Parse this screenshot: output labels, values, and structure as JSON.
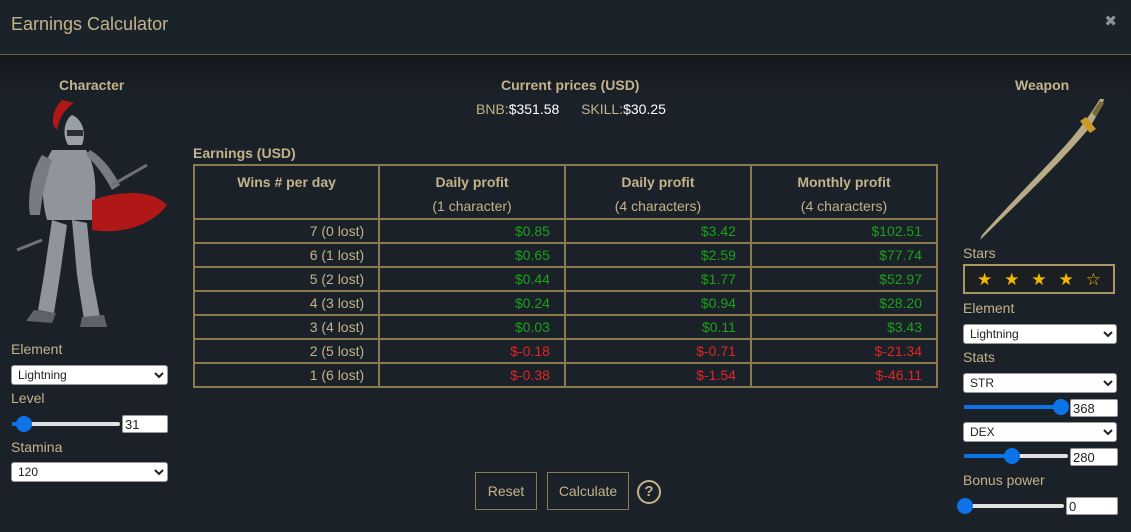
{
  "window": {
    "title": "Earnings Calculator",
    "close_icon": "close-icon"
  },
  "character": {
    "heading": "Character",
    "image": "armored-knight-figure",
    "element_label": "Element",
    "element_value": "Lightning",
    "level_label": "Level",
    "level_value": "31",
    "level_slider_fraction": 0.1,
    "stamina_label": "Stamina",
    "stamina_value": "120"
  },
  "prices": {
    "heading": "Current prices (USD)",
    "bnb_label": "BNB:",
    "bnb_value": "$351.58",
    "skill_label": "SKILL:",
    "skill_value": "$30.25"
  },
  "earnings": {
    "heading": "Earnings (USD)",
    "columns": [
      {
        "title": "Wins # per day",
        "sub": ""
      },
      {
        "title": "Daily profit",
        "sub": "(1 character)"
      },
      {
        "title": "Daily profit",
        "sub": "(4 characters)"
      },
      {
        "title": "Monthly profit",
        "sub": "(4 characters)"
      }
    ],
    "rows": [
      {
        "wins": "7 (0 lost)",
        "d1": "$0.85",
        "d4": "$3.42",
        "m4": "$102.51",
        "sign": "pos"
      },
      {
        "wins": "6 (1 lost)",
        "d1": "$0.65",
        "d4": "$2.59",
        "m4": "$77.74",
        "sign": "pos"
      },
      {
        "wins": "5 (2 lost)",
        "d1": "$0.44",
        "d4": "$1.77",
        "m4": "$52.97",
        "sign": "pos"
      },
      {
        "wins": "4 (3 lost)",
        "d1": "$0.24",
        "d4": "$0.94",
        "m4": "$28.20",
        "sign": "pos"
      },
      {
        "wins": "3 (4 lost)",
        "d1": "$0.03",
        "d4": "$0.11",
        "m4": "$3.43",
        "sign": "pos"
      },
      {
        "wins": "2 (5 lost)",
        "d1": "$-0.18",
        "d4": "$-0.71",
        "m4": "$-21.34",
        "sign": "neg"
      },
      {
        "wins": "1 (6 lost)",
        "d1": "$-0.38",
        "d4": "$-1.54",
        "m4": "$-46.11",
        "sign": "neg"
      }
    ]
  },
  "actions": {
    "reset_label": "Reset",
    "calculate_label": "Calculate",
    "help_label": "?",
    "help_icon": "help-icon"
  },
  "weapon": {
    "heading": "Weapon",
    "image": "curved-sword",
    "stars_label": "Stars",
    "stars_filled": 4,
    "stars_total": 5,
    "element_label": "Element",
    "element_value": "Lightning",
    "stats_label": "Stats",
    "stat1_name": "STR",
    "stat1_value": "368",
    "stat1_slider_fraction": 0.92,
    "stat2_name": "DEX",
    "stat2_value": "280",
    "stat2_slider_fraction": 0.45,
    "bonus_label": "Bonus power",
    "bonus_value": "0",
    "bonus_slider_fraction": 0.0
  },
  "colors": {
    "accent_gold": "#c4b38a",
    "positive": "#1ca01c",
    "negative": "#e02626",
    "slider": "#0d73e8"
  }
}
